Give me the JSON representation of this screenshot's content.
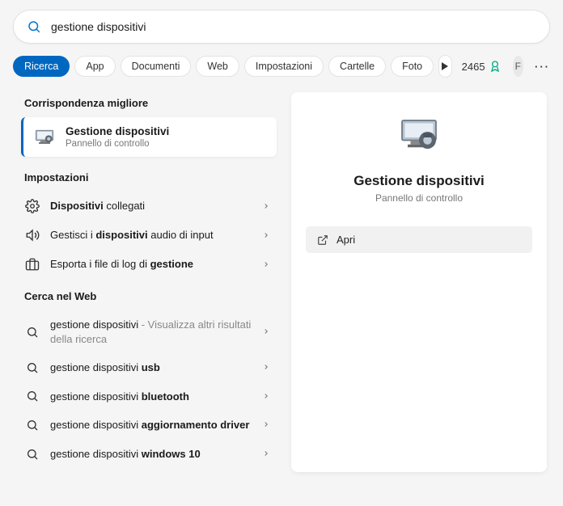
{
  "search": {
    "value": "gestione dispositivi"
  },
  "filters": {
    "items": [
      "Ricerca",
      "App",
      "Documenti",
      "Web",
      "Impostazioni",
      "Cartelle",
      "Foto"
    ],
    "active_index": 0
  },
  "rewards": {
    "points": "2465"
  },
  "user": {
    "initial": "F"
  },
  "left": {
    "best_match": {
      "header": "Corrispondenza migliore",
      "title": "Gestione dispositivi",
      "subtitle": "Pannello di controllo"
    },
    "settings": {
      "header": "Impostazioni",
      "items": [
        {
          "icon": "gear",
          "pre": "",
          "bold": "Dispositivi",
          "post": " collegati"
        },
        {
          "icon": "speaker",
          "pre": "Gestisci i ",
          "bold": "dispositivi",
          "post": " audio di input"
        },
        {
          "icon": "briefcase",
          "pre": "Esporta i file di log di ",
          "bold": "gestione",
          "post": ""
        }
      ]
    },
    "web": {
      "header": "Cerca nel Web",
      "items": [
        {
          "pre": "gestione dispositivi",
          "bold": "",
          "muted": " - Visualizza altri risultati della ricerca"
        },
        {
          "pre": "gestione dispositivi ",
          "bold": "usb",
          "muted": ""
        },
        {
          "pre": "gestione dispositivi ",
          "bold": "bluetooth",
          "muted": ""
        },
        {
          "pre": "gestione dispositivi ",
          "bold": "aggiornamento driver",
          "muted": ""
        },
        {
          "pre": "gestione dispositivi ",
          "bold": "windows 10",
          "muted": ""
        }
      ]
    }
  },
  "preview": {
    "title": "Gestione dispositivi",
    "subtitle": "Pannello di controllo",
    "open_label": "Apri"
  }
}
